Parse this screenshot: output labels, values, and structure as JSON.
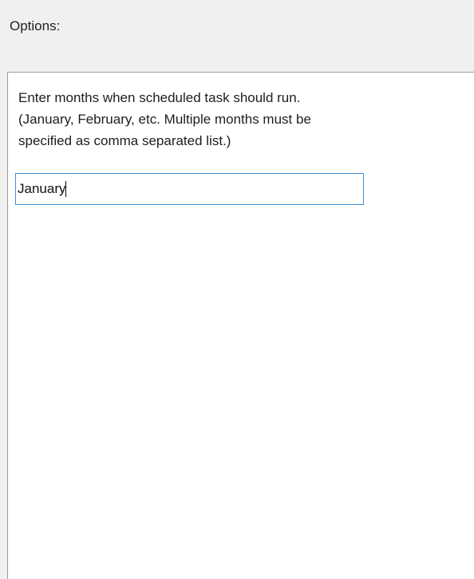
{
  "header": {
    "options_label": "Options:"
  },
  "instructions": {
    "line1": "Enter months when scheduled task should run.",
    "line2": "(January, February, etc. Multiple months must be",
    "line3": "specified as comma separated list.)"
  },
  "months_field": {
    "value": "January"
  }
}
